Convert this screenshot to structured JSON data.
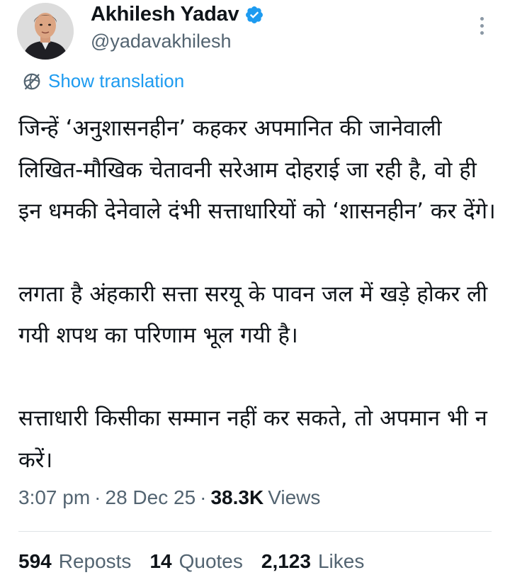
{
  "author": {
    "display_name": "Akhilesh Yadav",
    "handle": "@yadavakhilesh",
    "verified": true,
    "avatar": "profile-photo"
  },
  "translate": {
    "label": "Show translation",
    "icon": "globe-slash-icon"
  },
  "tweet": {
    "paragraphs": [
      "जिन्हें ‘अनुशासनहीन’ कहकर अपमानित की जानेवाली लिखित-मौखिक चेतावनी सरेआम दोहराई जा रही है, वो ही इन धमकी देनेवाले दंभी सत्ताधारियों को ‘शासनहीन’ कर देंगे।",
      "लगता है अंहकारी सत्ता सरयू के पावन जल में खड़े होकर ली गयी शपथ का परिणाम भूल गयी है।",
      "सत्ताधारी किसीका सम्मान नहीं कर सकते, तो अपमान भी न करें।"
    ]
  },
  "meta": {
    "time": "3:07 pm",
    "date": "28 Dec 25",
    "views_count": "38.3K",
    "views_label": "Views",
    "separator": "·"
  },
  "stats": {
    "reposts_count": "594",
    "reposts_label": "Reposts",
    "quotes_count": "14",
    "quotes_label": "Quotes",
    "likes_count": "2,123",
    "likes_label": "Likes"
  },
  "colors": {
    "accent": "#1d9bf0",
    "secondary_text": "#536471",
    "primary_text": "#0f1419"
  }
}
